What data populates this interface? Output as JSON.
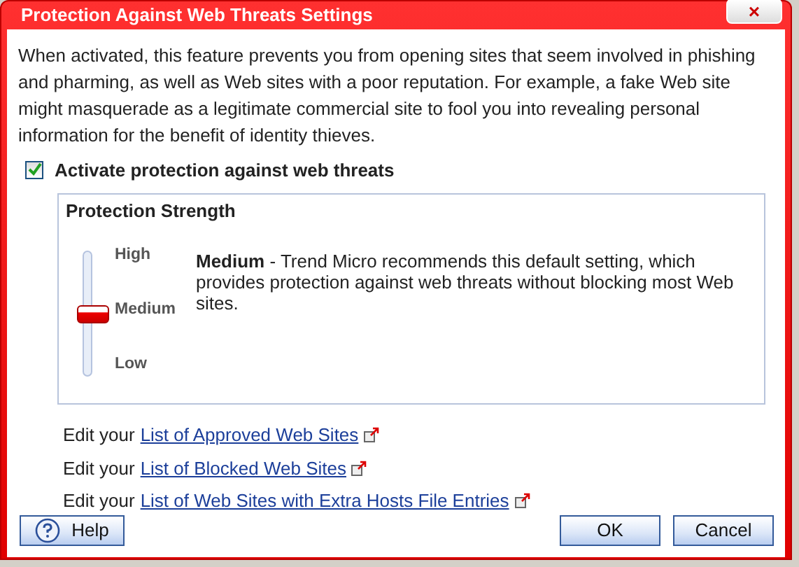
{
  "window": {
    "title": "Protection Against Web Threats Settings",
    "close": "×"
  },
  "description": "When activated, this feature prevents you from opening sites that seem involved in phishing and pharming, as well as Web sites with a poor reputation. For example, a fake Web site might masquerade as a legitimate commercial site to fool you into revealing personal information for the benefit of identity thieves.",
  "activate": {
    "label": "Activate protection against web threats",
    "checked": true
  },
  "strength": {
    "title": "Protection Strength",
    "slider": {
      "level": 0.5
    },
    "ticks": [
      "High",
      "Medium",
      "Low"
    ],
    "explanation": "**Medium** - Trend Micro recommends this default setting, which provides protection against web threats without blocking most Web sites."
  },
  "links": [
    {
      "prefix": "Edit your",
      "link": "List of Approved Web Sites"
    },
    {
      "prefix": "Edit your",
      "link": "List of Blocked Web Sites "
    },
    {
      "prefix": "Edit your",
      "link": "List of Web Sites with Extra Hosts File Entries "
    }
  ],
  "buttons": [
    {
      "label": "Help",
      "kind": "help"
    },
    {
      "label": "OK",
      "kind": "plain"
    },
    {
      "label": "Cancel",
      "kind": "plain"
    }
  ]
}
